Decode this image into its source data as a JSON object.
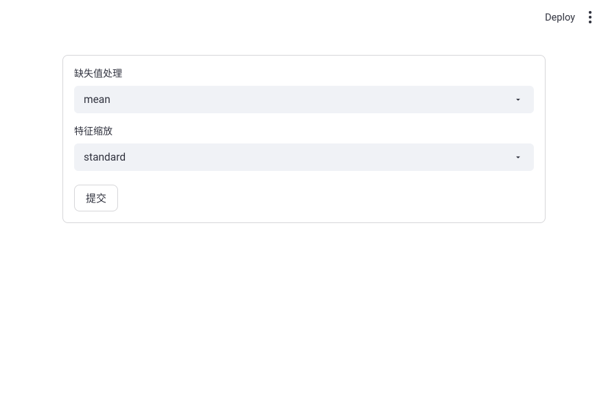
{
  "header": {
    "deploy_label": "Deploy"
  },
  "form": {
    "missing_value": {
      "label": "缺失值处理",
      "selected": "mean"
    },
    "feature_scaling": {
      "label": "特征缩放",
      "selected": "standard"
    },
    "submit_label": "提交"
  }
}
